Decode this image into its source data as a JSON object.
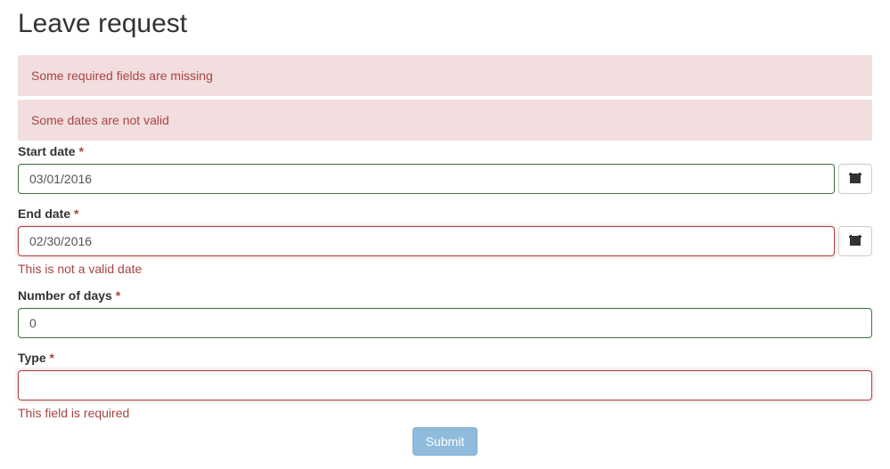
{
  "page_title": "Leave request",
  "alerts": [
    "Some required fields are missing",
    "Some dates are not valid"
  ],
  "form": {
    "start_date": {
      "label": "Start date",
      "value": "03/01/2016",
      "state": "valid"
    },
    "end_date": {
      "label": "End date",
      "value": "02/30/2016",
      "state": "invalid",
      "error": "This is not a valid date"
    },
    "number_of_days": {
      "label": "Number of days",
      "value": "0",
      "state": "valid"
    },
    "type": {
      "label": "Type",
      "value": "",
      "state": "invalid",
      "error": "This field is required"
    }
  },
  "required_mark": "*",
  "submit_label": "Submit"
}
